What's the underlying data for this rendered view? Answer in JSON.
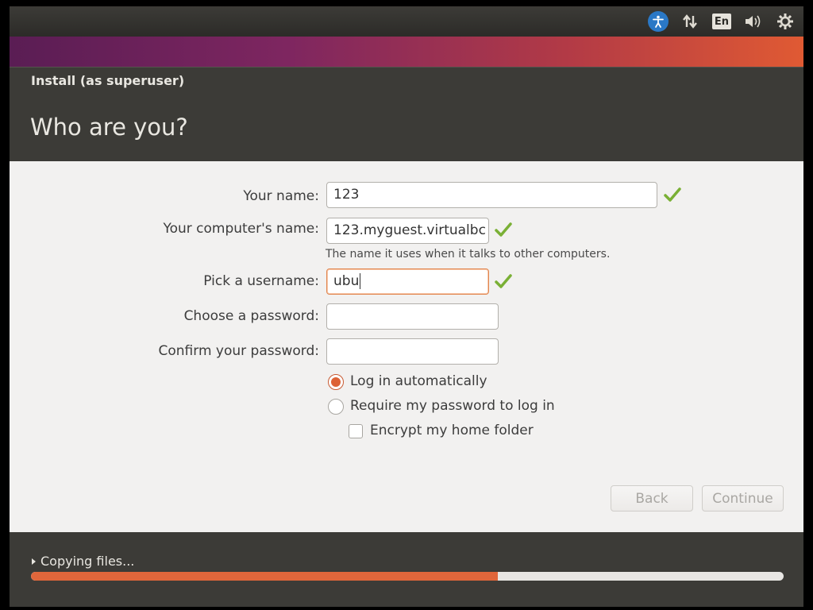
{
  "tray": {
    "accessibility_icon": "accessibility-icon",
    "network_icon": "network-updown-icon",
    "keyboard_layout": "En",
    "volume_icon": "volume-icon",
    "settings_icon": "gear-icon"
  },
  "window": {
    "title": "Install (as superuser)",
    "heading": "Who are you?"
  },
  "form": {
    "name_label": "Your name:",
    "name_value": "123",
    "computer_label": "Your computer's name:",
    "computer_value": "123.myguest.virtualbc",
    "computer_hint": "The name it uses when it talks to other computers.",
    "username_label": "Pick a username:",
    "username_value": "ubu",
    "password_label": "Choose a password:",
    "password_value": "",
    "confirm_label": "Confirm your password:",
    "confirm_value": "",
    "login_auto_label": "Log in automatically",
    "login_auto_selected": true,
    "require_password_label": "Require my password to log in",
    "encrypt_label": "Encrypt my home folder",
    "encrypt_checked": false
  },
  "buttons": {
    "back": "Back",
    "continue": "Continue"
  },
  "footer": {
    "status": "Copying files...",
    "progress_fraction": 0.62
  },
  "colors": {
    "accent": "#dd6236",
    "valid_check": "#7ab035",
    "header_bg": "#3c3b37"
  }
}
